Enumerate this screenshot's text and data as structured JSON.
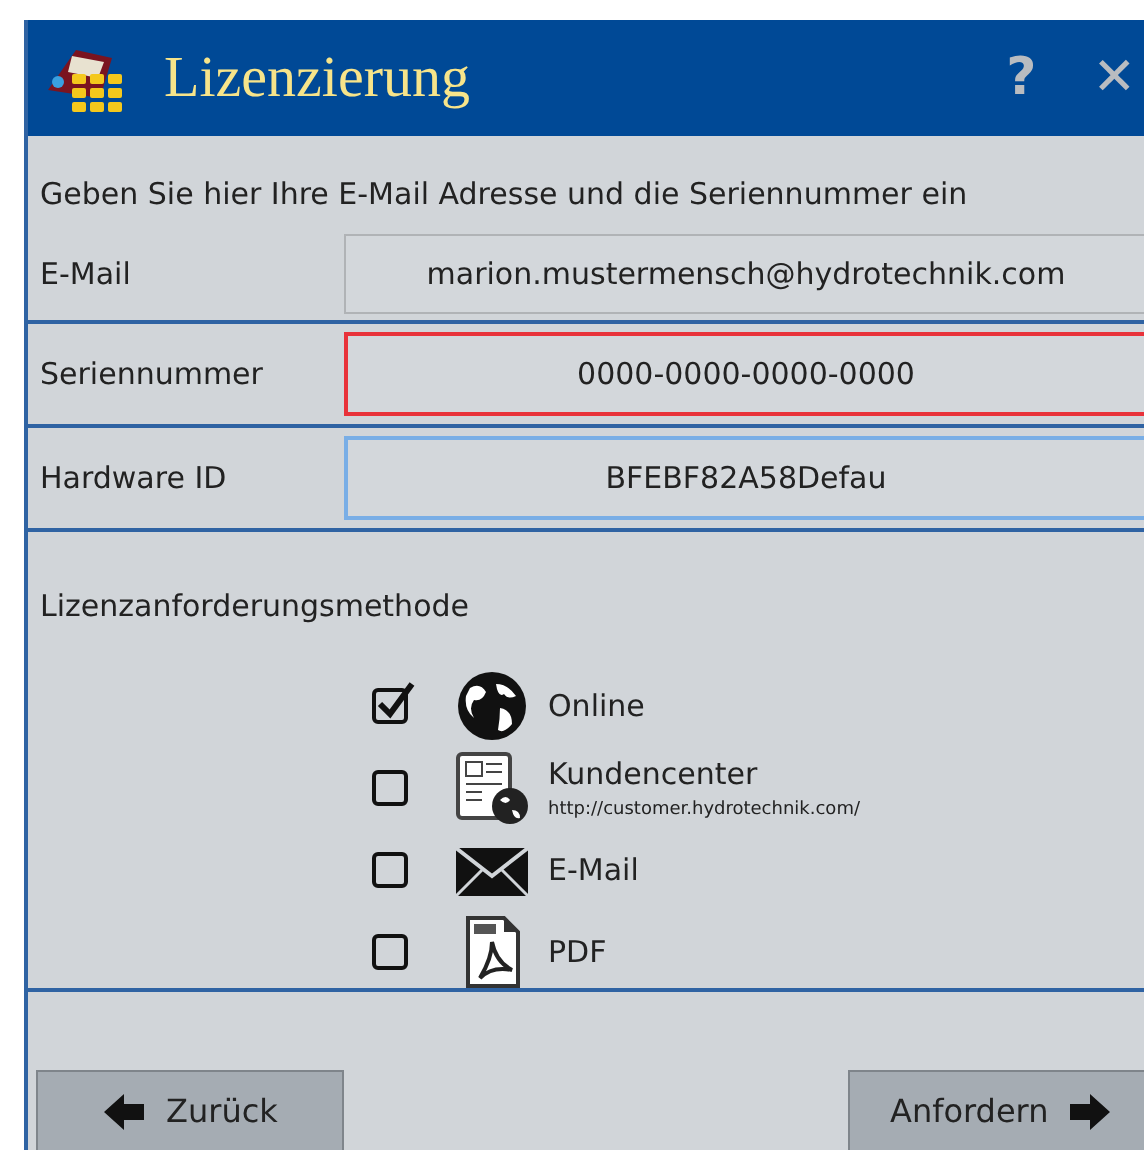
{
  "window": {
    "title": "Lizenzierung",
    "buttons": [
      {
        "kind": "help",
        "label": "?"
      },
      {
        "kind": "close",
        "label": "✕"
      }
    ]
  },
  "instruction": "Geben Sie hier Ihre E-Mail Adresse und die Seriennummer ein",
  "fields": [
    {
      "label": "E-Mail",
      "value": "marion.mustermensch@hydrotechnik.com",
      "invalid": false,
      "focused": false
    },
    {
      "label": "Seriennummer",
      "value": "0000-0000-0000-0000",
      "invalid": true,
      "focused": false
    },
    {
      "label": "Hardware ID",
      "value": "BFEBF82A58Defau",
      "invalid": false,
      "focused": true
    }
  ],
  "methods_label": "Lizenzanforderungsmethode",
  "methods": [
    {
      "kind": "globe",
      "label": "Online",
      "checked": true
    },
    {
      "kind": "portal",
      "label": "Kundencenter",
      "url": "http://customer.hydrotechnik.com/",
      "checked": false
    },
    {
      "kind": "mail",
      "label": "E-Mail",
      "checked": false
    },
    {
      "kind": "pdf",
      "label": "PDF",
      "checked": false
    }
  ],
  "footer_buttons": [
    {
      "kind": "back",
      "label": "Zurück"
    },
    {
      "kind": "next",
      "label": "Anfordern"
    }
  ]
}
